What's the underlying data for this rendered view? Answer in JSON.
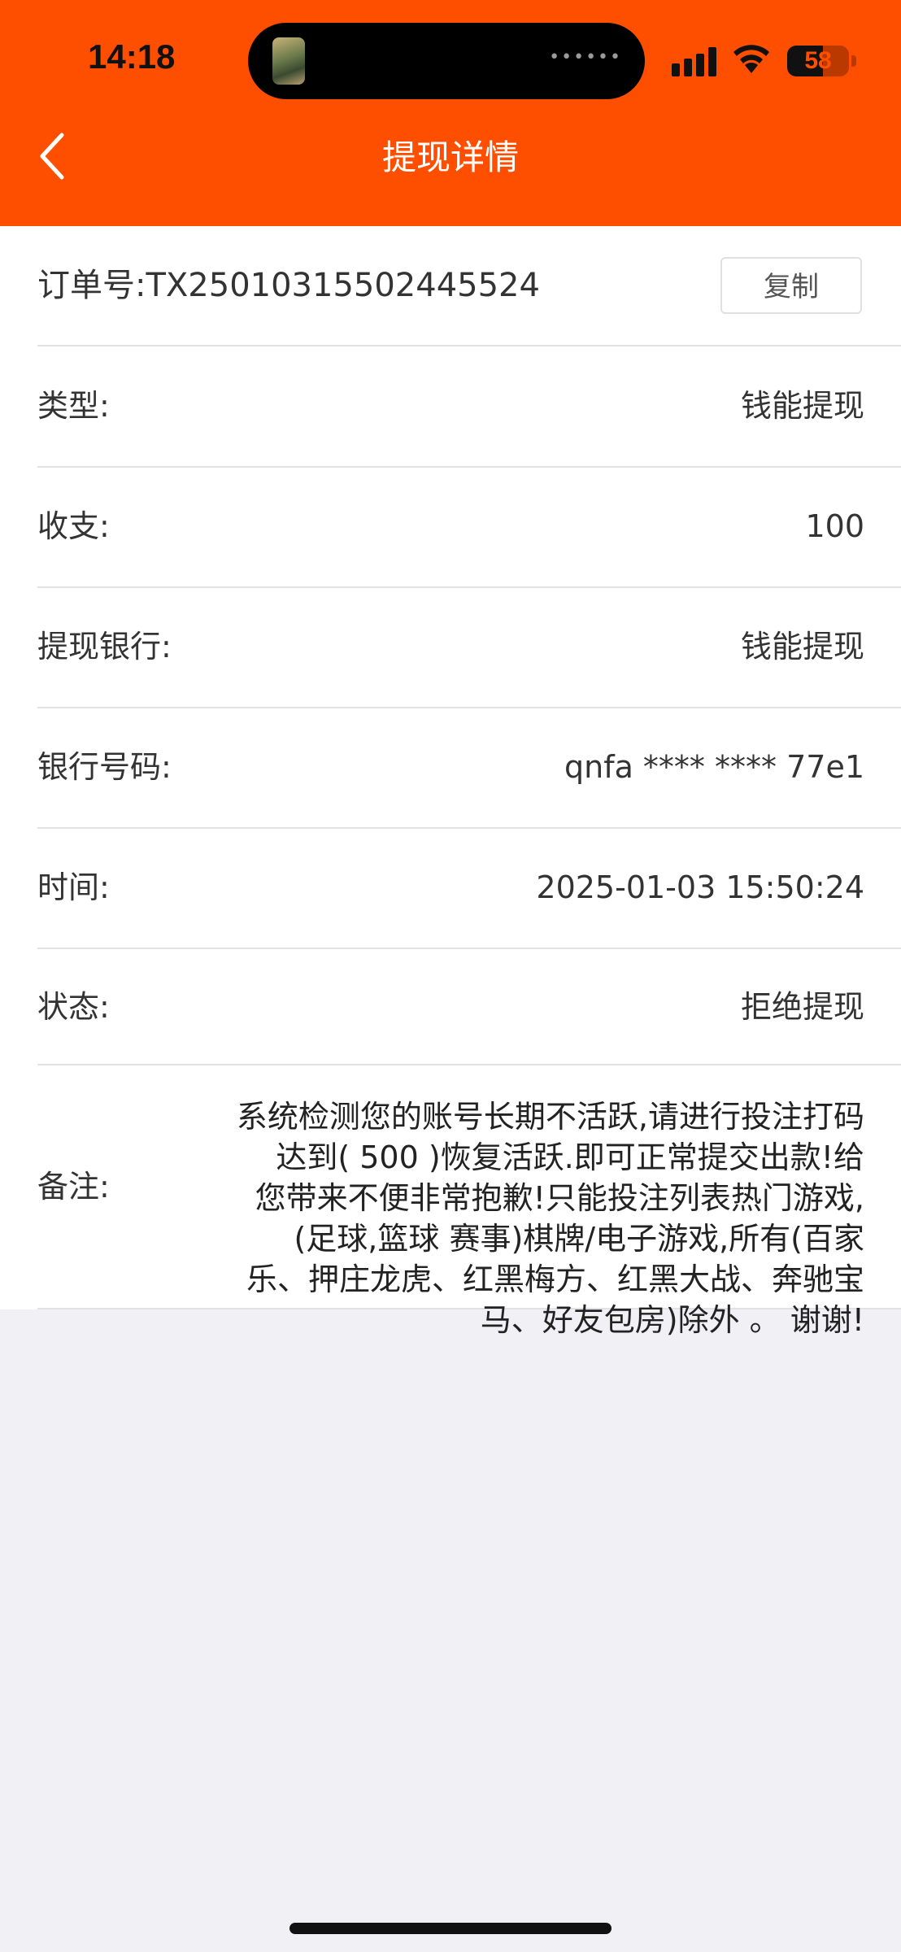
{
  "status_bar": {
    "time": "14:18",
    "battery": "58",
    "battery_level": 0.58
  },
  "nav": {
    "title": "提现详情",
    "back_icon": "chevron-left-icon"
  },
  "order": {
    "label": "订单号:TX25010315502445524",
    "copy_label": "复制"
  },
  "details": [
    {
      "label": "类型:",
      "value": "钱能提现"
    },
    {
      "label": "收支:",
      "value": "100"
    },
    {
      "label": "提现银行:",
      "value": "钱能提现"
    },
    {
      "label": "银行号码:",
      "value": "qnfa **** **** 77e1"
    },
    {
      "label": "时间:",
      "value": "2025-01-03 15:50:24"
    },
    {
      "label": "状态:",
      "value": "拒绝提现"
    }
  ],
  "remark": {
    "label": "备注:",
    "lines": [
      "系统检测您的账号长期不活跃,请进行投注打码",
      "达到( 500 )恢复活跃.即可正常提交出款!给",
      "您带来不便非常抱歉!只能投注列表热门游戏,",
      "(足球,篮球 赛事)棋牌/电子游戏,所有(百家",
      "乐、押庄龙虎、红黑梅方、红黑大战、奔驰宝",
      "马、好友包房)除外 。 谢谢!"
    ]
  },
  "colors": {
    "accent": "#fe4e00",
    "page_background": "#f0f0f5"
  }
}
